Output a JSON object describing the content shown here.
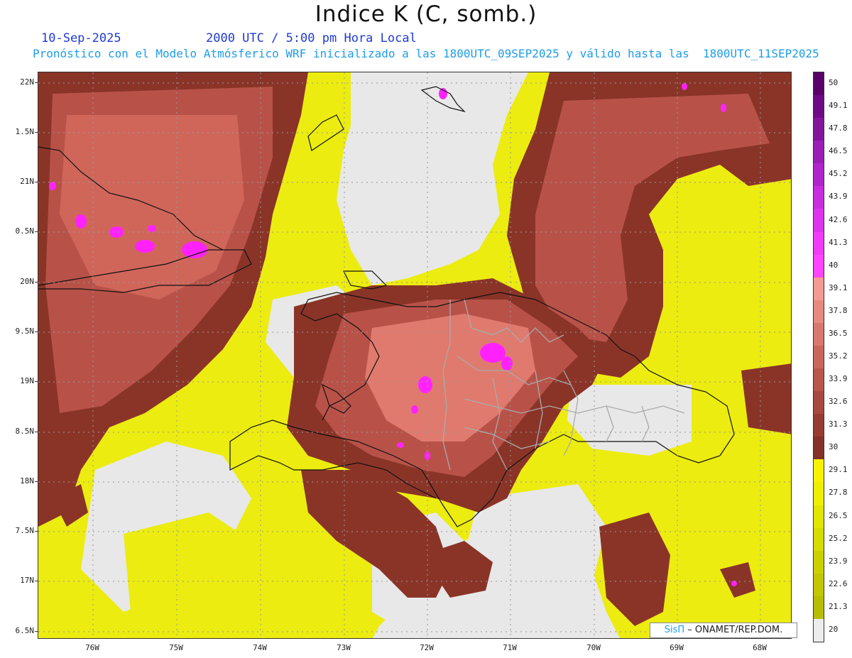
{
  "header": {
    "title": "Indice K (C, somb.)",
    "date": "10-Sep-2025",
    "time": "2000 UTC / 5:00 pm Hora Local",
    "subtitle": "Pronóstico con el Modelo Atmósferico WRF inicializado a las 1800UTC_09SEP2025 y válido hasta las  1800UTC_11SEP2025"
  },
  "axes": {
    "lat_labels": [
      "22N",
      "1.5N",
      "21N",
      "0.5N",
      "20N",
      "9.5N",
      "19N",
      "8.5N",
      "18N",
      "7.5N",
      "17N",
      "6.5N"
    ],
    "lon_labels": [
      "76W",
      "75W",
      "74W",
      "73W",
      "72W",
      "71W",
      "70W",
      "69W",
      "68W"
    ]
  },
  "colorbar": {
    "levels": [
      "50",
      "49.1",
      "47.8",
      "46.5",
      "45.2",
      "43.9",
      "42.6",
      "41.3",
      "40",
      "39.1",
      "37.8",
      "36.5",
      "35.2",
      "33.9",
      "32.6",
      "31.3",
      "30",
      "29.1",
      "27.8",
      "26.5",
      "25.2",
      "23.9",
      "22.6",
      "21.3",
      "20"
    ],
    "colors": [
      "#5a006a",
      "#6e0a86",
      "#83159b",
      "#9a1fb5",
      "#b024cc",
      "#c82de0",
      "#dd33ef",
      "#f03cf9",
      "#ff44ff",
      "#f39a92",
      "#e68a80",
      "#d9786e",
      "#c9675d",
      "#b8574c",
      "#a8493f",
      "#973c33",
      "#86302a",
      "#f9f200",
      "#eef000",
      "#e2e600",
      "#d6dc00",
      "#cbd100",
      "#c1c700",
      "#b8bd00",
      "#ececec"
    ]
  },
  "map": {
    "background": "#e8e8e8",
    "yellow": "#ecec10",
    "brown_dark": "#8a3428",
    "brown_mid": "#b85248",
    "brown_light": "#e07a6e",
    "magenta": "#ff22ff",
    "coast": "#111111",
    "borders": "#aaaaaa"
  },
  "credit": {
    "sis": "SisΠ",
    "org": "– ONAMET/REP.DOM."
  }
}
